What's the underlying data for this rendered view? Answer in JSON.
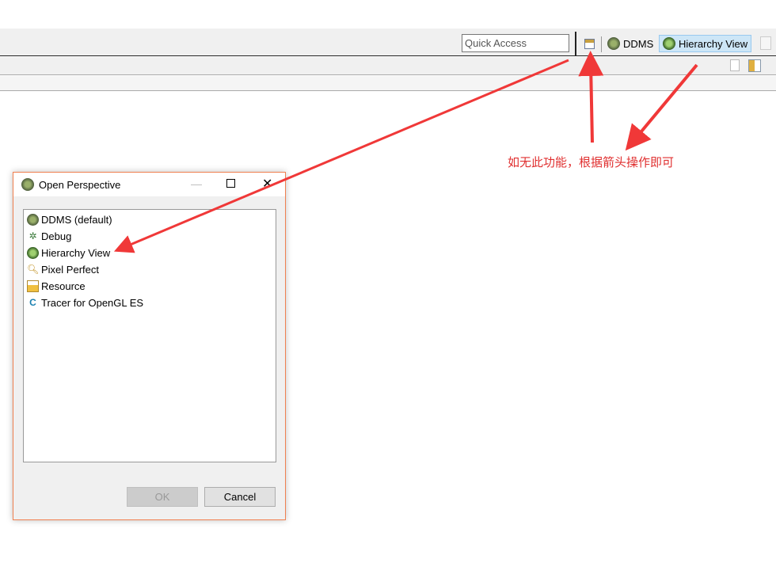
{
  "toolbar": {
    "quick_access_placeholder": "Quick Access",
    "perspectives": [
      {
        "label": "DDMS",
        "icon": "ddms-icon"
      },
      {
        "label": "Hierarchy View",
        "icon": "hierarchy-view-icon",
        "active": true
      }
    ]
  },
  "dialog": {
    "title": "Open Perspective",
    "items": [
      {
        "label": "DDMS (default)",
        "icon": "ddms-icon"
      },
      {
        "label": "Debug",
        "icon": "bug-icon"
      },
      {
        "label": "Hierarchy View",
        "icon": "hierarchy-view-icon"
      },
      {
        "label": "Pixel Perfect",
        "icon": "magnifier-icon"
      },
      {
        "label": "Resource",
        "icon": "folder-icon"
      },
      {
        "label": "Tracer for OpenGL ES",
        "icon": "tracer-icon"
      }
    ],
    "ok_label": "OK",
    "cancel_label": "Cancel"
  },
  "annotation": {
    "text": "如无此功能，根据箭头操作即可",
    "color": "#e03030"
  }
}
